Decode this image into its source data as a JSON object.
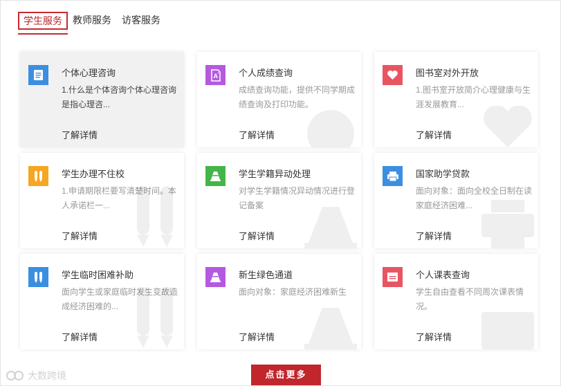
{
  "tabs": [
    {
      "label": "学生服务"
    },
    {
      "label": "教师服务"
    },
    {
      "label": "访客服务"
    }
  ],
  "colors": {
    "accent": "#c8282e",
    "blue": "#3b8fe0",
    "purple": "#b45ae0",
    "red": "#e85562",
    "orange": "#f5a623",
    "green": "#44b549"
  },
  "cards": [
    {
      "title": "个体心理咨询",
      "desc": "1.什么是个体咨询个体心理咨询是指心理咨...",
      "more": "了解详情",
      "icon": "document-icon"
    },
    {
      "title": "个人成绩查询",
      "desc": "成绩查询功能，提供不同学期成绩查询及打印功能。",
      "more": "了解详情",
      "icon": "font-file-icon"
    },
    {
      "title": "图书室对外开放",
      "desc": "1.图书室开放简介心理健康与生涯发展教育...",
      "more": "了解详情",
      "icon": "heart-icon"
    },
    {
      "title": "学生办理不住校",
      "desc": "1.申请期限栏要写清楚时间。本人承诺栏一...",
      "more": "了解详情",
      "icon": "pencils-icon"
    },
    {
      "title": "学生学籍异动处理",
      "desc": "对学生学籍情况异动情况进行登记备案",
      "more": "了解详情",
      "icon": "cone-icon"
    },
    {
      "title": "国家助学贷款",
      "desc": "面向对象：面向全校全日制在读家庭经济困难...",
      "more": "了解详情",
      "icon": "printer-icon"
    },
    {
      "title": "学生临时困难补助",
      "desc": "面向学生或家庭临时发生变故造成经济困难的...",
      "more": "了解详情",
      "icon": "pencils-icon"
    },
    {
      "title": "新生绿色通道",
      "desc": "面向对象：家庭经济困难新生",
      "more": "了解详情",
      "icon": "cone-icon"
    },
    {
      "title": "个人课表查询",
      "desc": "学生自由查看不同周次课表情况。",
      "more": "了解详情",
      "icon": "schedule-icon"
    }
  ],
  "more_button": "点击更多",
  "watermark": "大数跨境"
}
